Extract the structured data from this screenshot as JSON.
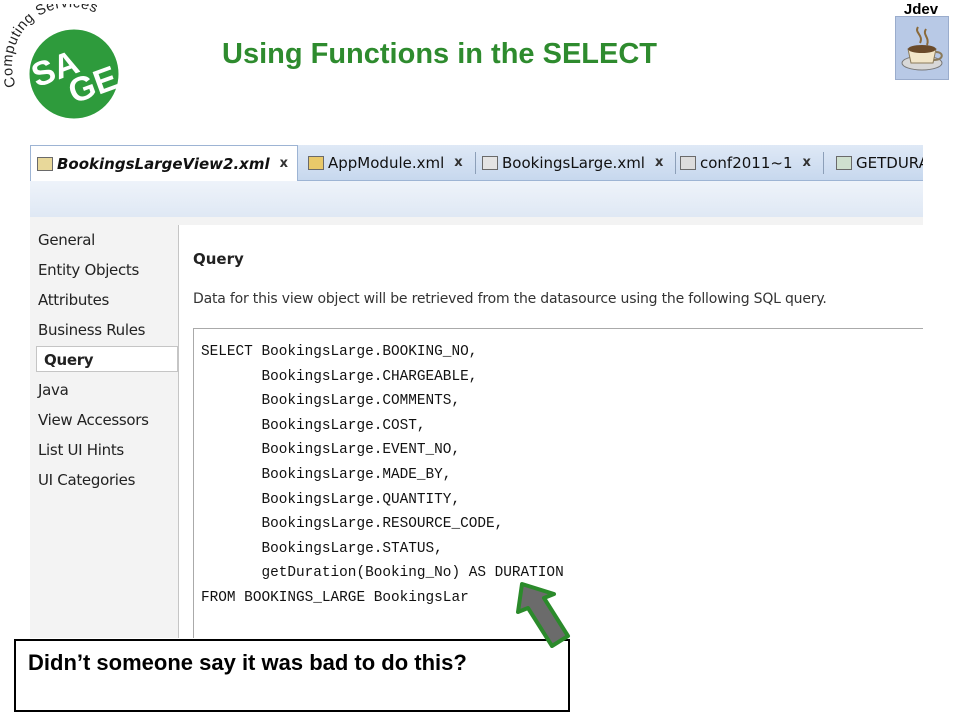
{
  "slide": {
    "title": "Using Functions in the SELECT",
    "badge_label": "Jdev",
    "badge_icon": "coffee-cup-icon",
    "logo": {
      "main": "SAGE",
      "arc_text": "Computing Services",
      "color": "#2e9b3c"
    }
  },
  "ide": {
    "tabs": [
      {
        "label": "BookingsLargeView2.xml",
        "icon": "view-object-icon",
        "active": true
      },
      {
        "label": "AppModule.xml",
        "icon": "app-module-icon"
      },
      {
        "label": "BookingsLarge.xml",
        "icon": "entity-object-icon"
      },
      {
        "label": "conf2011~1",
        "icon": "connection-icon"
      },
      {
        "label": "GETDURA",
        "icon": "function-icon"
      }
    ],
    "nav": [
      "General",
      "Entity Objects",
      "Attributes",
      "Business Rules",
      "Query",
      "Java",
      "View Accessors",
      "List UI Hints",
      "UI Categories"
    ],
    "selected_nav": "Query",
    "section_title": "Query",
    "description": "Data for this view object will be retrieved from the datasource using the following SQL query.",
    "sql": "SELECT BookingsLarge.BOOKING_NO,\n       BookingsLarge.CHARGEABLE,\n       BookingsLarge.COMMENTS,\n       BookingsLarge.COST,\n       BookingsLarge.EVENT_NO,\n       BookingsLarge.MADE_BY,\n       BookingsLarge.QUANTITY,\n       BookingsLarge.RESOURCE_CODE,\n       BookingsLarge.STATUS,\n       getDuration(Booking_No) AS DURATION\nFROM BOOKINGS_LARGE BookingsLar"
  },
  "callout": {
    "text": "Didn’t someone say it was bad to do this?"
  },
  "colors": {
    "title": "#2e8b2e",
    "arrow": "#6b6b6b",
    "arrow_outline": "#2b8a2b"
  }
}
